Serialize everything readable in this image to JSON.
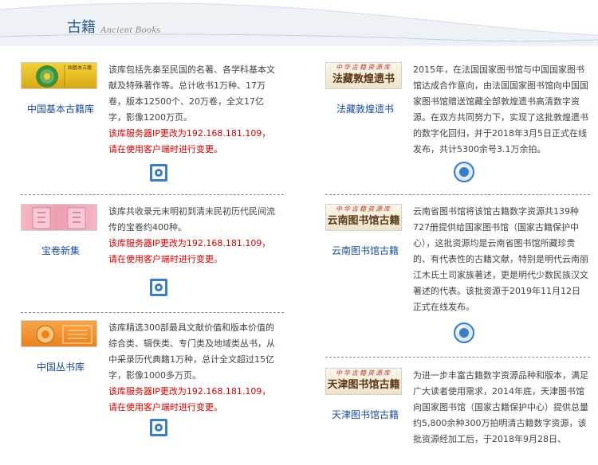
{
  "header": {
    "title_cn": "古籍",
    "title_en": "Ancient Books"
  },
  "colors": {
    "link": "#1c4a9a",
    "notice": "#d40000",
    "heading": "#2a5b8c"
  },
  "left_items": [
    {
      "name": "中国基本古籍库",
      "thumb_text": "国基本古籍",
      "desc": "该库包括先秦至民国的名著、各学科基本文献及特殊著作等。总计收书1万种、17万卷，版本12500个、20万卷，全文17亿字，影像1200万页。",
      "notice": "该库服务器IP更改为192.168.181.109，请在使用客户端时进行变更。",
      "icon": "client-access-icon"
    },
    {
      "name": "宝卷新集",
      "desc": "该库共收录元末明初到清末民初历代民间流传的宝卷约400种。",
      "notice": "该库服务器IP更改为192.168.181.109，请在使用客户端时进行变更。",
      "icon": "client-access-icon"
    },
    {
      "name": "中国丛书库",
      "desc": "该库精选300部最具文献价值和版本价值的综合类、辑佚类、专门类及地域类丛书，从中采录历代典籍1万种，总计全文超过15亿字，影像1000多万页。",
      "notice": "该库服务器IP更改为192.168.181.109，请在使用客户端时进行变更。",
      "icon": "client-access-icon"
    }
  ],
  "right_items": [
    {
      "name": "法藏敦煌遗书",
      "banner_top": "中华古籍资源库",
      "banner_main": "法藏敦煌遗书",
      "desc": "2015年，在法国国家图书馆与中国国家图书馆达成合作意向，由法国国家图书馆向中国国家图书馆赠送馆藏全部敦煌遗书高清数字资源。在双方共同努力下，实现了这批敦煌遗书的数字化回归，并于2018年3月5日正式在线发布，共计5300余号3.1万余拍。",
      "icon": "web-access-icon"
    },
    {
      "name": "云南图书馆古籍",
      "banner_top": "中华古籍资源库",
      "banner_main": "云南图书馆古籍",
      "desc": "云南省图书馆将该馆古籍数字资源共139种727册提供给国家图书馆（国家古籍保护中心），这批资源均是云南省图书馆所藏珍贵的、有代表性的古籍文献，特别是明代云南丽江木氏土司家族著述，更是明代少数民族汉文著述的代表。该批资源于2019年11月12日正式在线发布。",
      "icon": "web-access-icon"
    },
    {
      "name": "天津图书馆古籍",
      "banner_top": "中华古籍资源库",
      "banner_main": "天津图书馆古籍",
      "desc": "为进一步丰富古籍数字资源品种和版本，满足广大读者使用需求，2014年底，天津图书馆向国家图书馆（国家古籍保护中心）提供总量约5,800余种300万拍明清古籍数字资源，该批资源经加工后，于2018年9月28日、",
      "icon": "web-access-icon"
    }
  ]
}
